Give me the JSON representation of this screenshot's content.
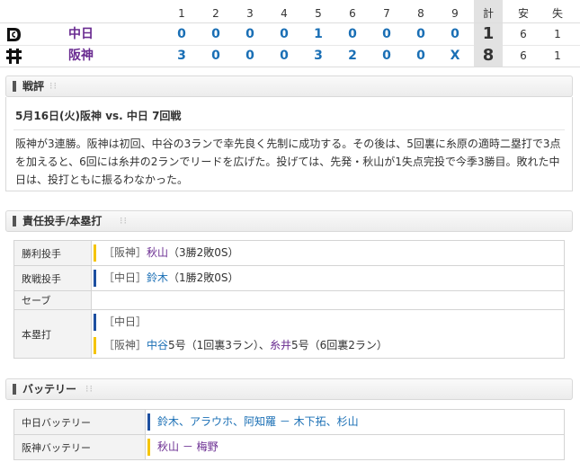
{
  "scoreboard": {
    "headers": [
      "1",
      "2",
      "3",
      "4",
      "5",
      "6",
      "7",
      "8",
      "9",
      "計",
      "安",
      "失"
    ],
    "teams": [
      {
        "name": "中日",
        "logo": "dragons-logo-icon",
        "innings": [
          "0",
          "0",
          "0",
          "0",
          "1",
          "0",
          "0",
          "0",
          "0"
        ],
        "total": "1",
        "hits": "6",
        "errors": "1"
      },
      {
        "name": "阪神",
        "logo": "tigers-logo-icon",
        "innings": [
          "3",
          "0",
          "0",
          "0",
          "3",
          "2",
          "0",
          "0",
          "X"
        ],
        "total": "8",
        "hits": "6",
        "errors": "1"
      }
    ]
  },
  "review": {
    "header": "戦評",
    "date_line": "5月16日(火)阪神 vs. 中日 7回戦",
    "text": "阪神が3連勝。阪神は初回、中谷の3ランで幸先良く先制に成功する。その後は、5回裏に糸原の適時二塁打で3点を加えると、6回には糸井の2ランでリードを広げた。投げては、先発・秋山が1失点完投で今季3勝目。敗れた中日は、投打ともに振るわなかった。"
  },
  "pitchers": {
    "header": "責任投手/本塁打",
    "rows": [
      {
        "label": "勝利投手",
        "entries": [
          {
            "team": "［阪神］",
            "player": "秋山",
            "player_team": "tigers",
            "note": "（3勝2敗0S）",
            "stripe": "#f5c400"
          }
        ]
      },
      {
        "label": "敗戦投手",
        "entries": [
          {
            "team": "［中日］",
            "player": "鈴木",
            "player_team": "dragons",
            "note": "（1勝2敗0S）",
            "stripe": "#1d4fa0"
          }
        ]
      },
      {
        "label": "セーブ",
        "entries": []
      },
      {
        "label": "本塁打",
        "entries": [
          {
            "team": "［中日］",
            "player": "",
            "player_team": "dragons",
            "note": "",
            "stripe": "#1d4fa0"
          },
          {
            "team": "［阪神］",
            "player": "中谷",
            "player_team": "dragons",
            "note": "5号（1回裏3ラン）、",
            "player2": "糸井",
            "note2": "5号（6回裏2ラン）",
            "stripe": "#f5c400"
          }
        ]
      }
    ]
  },
  "battery": {
    "header": "バッテリー",
    "rows": [
      {
        "label": "中日バッテリー",
        "value": "鈴木、アラウホ、阿知羅 － 木下拓、杉山",
        "stripe": "#1d4fa0"
      },
      {
        "label": "阪神バッテリー",
        "value": "秋山 － 梅野",
        "stripe": "#f5c400"
      }
    ]
  }
}
